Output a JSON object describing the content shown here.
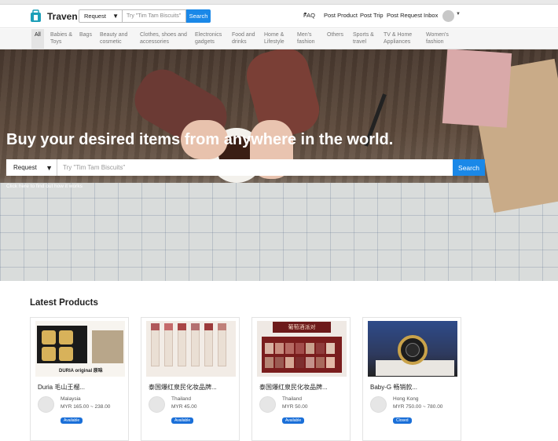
{
  "header": {
    "brand": "Traven",
    "search": {
      "type_value": "Request",
      "placeholder": "Try \"Tim Tam Biscuits\"",
      "button": "Search"
    },
    "nav": {
      "faq": "FAQ",
      "post_product": "Post Product",
      "post_trip": "Post Trip",
      "post_request": "Post Request",
      "inbox": "Inbox"
    },
    "colors": {
      "accent": "#1a88e8"
    }
  },
  "categories": [
    {
      "label": "All",
      "active": true
    },
    {
      "label": "Babies & Toys"
    },
    {
      "label": "Bags"
    },
    {
      "label": "Beauty and cosmetic"
    },
    {
      "label": "Clothes, shoes and accessories"
    },
    {
      "label": "Electronics gadgets"
    },
    {
      "label": "Food and drinks"
    },
    {
      "label": "Home & Lifestyle"
    },
    {
      "label": "Men's fashion"
    },
    {
      "label": "Others"
    },
    {
      "label": "Sports & travel"
    },
    {
      "label": "TV & Home Appliances"
    },
    {
      "label": "Women's fashion"
    }
  ],
  "hero": {
    "title": "Buy your desired items from anywhere in the world.",
    "search": {
      "type_value": "Request",
      "placeholder": "Try \"Tim Tam Biscuits\"",
      "button": "Search"
    },
    "link": "Click here to find out how it works"
  },
  "products": {
    "title": "Latest Products",
    "items": [
      {
        "name": "Duria 毛山王榴...",
        "image_caption": "DURIA original 原味",
        "location": "Malaysia",
        "price": "MYR 165.00 ~ 238.00",
        "status": "Available"
      },
      {
        "name": "泰国爆红泉民化妆品牌...",
        "location": "Thailand",
        "price": "MYR 45.00",
        "status": "Available"
      },
      {
        "name": "泰国爆红泉民化妆品牌...",
        "image_caption": "葡萄酒派对",
        "location": "Thailand",
        "price": "MYR 50.00",
        "status": "Available"
      },
      {
        "name": "Baby-G 畅销款...",
        "location": "Hong Kong",
        "price": "MYR 750.00 ~ 780.00",
        "status": "Closed"
      }
    ]
  }
}
